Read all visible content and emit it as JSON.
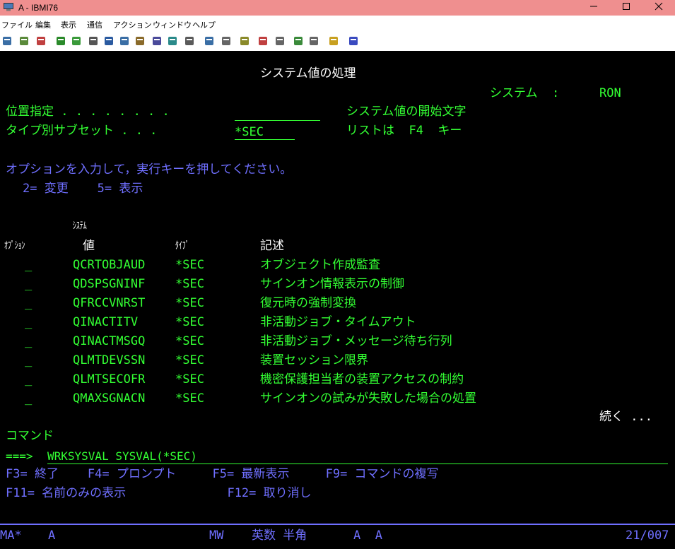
{
  "window": {
    "title": "A - IBMI76"
  },
  "menu": [
    "ファイル",
    "編集",
    "表示",
    "通信",
    "アクション",
    "ウィンドウ",
    "ヘルプ"
  ],
  "toolbar_icons": [
    "print-screen-icon",
    "copy-icon",
    "paste-icon",
    "send-file-icon",
    "receive-file-icon",
    "macro-icon",
    "record-icon",
    "display-icon",
    "keypad-icon",
    "session-icon",
    "color-icon",
    "config-icon",
    "keyboard-icon",
    "grid-icon",
    "tools-icon",
    "connect-icon",
    "disconnect-icon",
    "upload-icon",
    "download-icon",
    "notes-icon",
    "help-icon"
  ],
  "screen": {
    "title": "システム値の処理",
    "system_label": "システム  :",
    "system_name": "RON",
    "position_label": "位置指定 . . . . . . . .",
    "position_value": "",
    "position_help": "システム値の開始文字",
    "subset_label": "タイプ別サブセット . . .",
    "subset_value": "*SEC",
    "subset_help": "リストは  F4  キー",
    "instruction": "オプションを入力して，実行キーを押してください。",
    "options": "2= 変更    5= 表示",
    "col_system": "ｼｽﾃﾑ",
    "col_option": "ｵﾌﾟｼｮﾝ",
    "col_value": "値",
    "col_type": "ﾀｲﾌﾟ",
    "col_desc": "記述",
    "rows": [
      {
        "opt": "_",
        "name": "QCRTOBJAUD",
        "type": "*SEC",
        "desc": "オブジェクト作成監査"
      },
      {
        "opt": "_",
        "name": "QDSPSGNINF",
        "type": "*SEC",
        "desc": "サインオン情報表示の制御"
      },
      {
        "opt": "_",
        "name": "QFRCCVNRST",
        "type": "*SEC",
        "desc": "復元時の強制変換"
      },
      {
        "opt": "_",
        "name": "QINACTITV",
        "type": "*SEC",
        "desc": "非活動ジョブ・タイムアウト"
      },
      {
        "opt": "_",
        "name": "QINACTMSGQ",
        "type": "*SEC",
        "desc": "非活動ジョブ・メッセージ待ち行列"
      },
      {
        "opt": "_",
        "name": "QLMTDEVSSN",
        "type": "*SEC",
        "desc": "装置セッション限界"
      },
      {
        "opt": "_",
        "name": "QLMTSECOFR",
        "type": "*SEC",
        "desc": "機密保護担当者の装置アクセスの制約"
      },
      {
        "opt": "_",
        "name": "QMAXSGNACN",
        "type": "*SEC",
        "desc": "サインオンの試みが失敗した場合の処置"
      }
    ],
    "more": "続く ...",
    "command_label": "コマンド",
    "command_prompt": "===>",
    "command_value": "WRKSYSVAL SYSVAL(*SEC)",
    "fkeys_line1": "F3= 終了    F4= プロンプト     F5= 最新表示     F9= コマンドの複写",
    "fkeys_line2": "F11= 名前のみの表示              F12= 取り消し"
  },
  "status": {
    "session": "MA*",
    "sess_id": "A",
    "mode": "MW",
    "ime": "英数 半角",
    "flags": "A  A",
    "position": "21/007"
  },
  "colors": {
    "title_bar": "#ef8f8f",
    "green": "#33ff33",
    "blue": "#6f6fff",
    "white": "#ffffff"
  }
}
